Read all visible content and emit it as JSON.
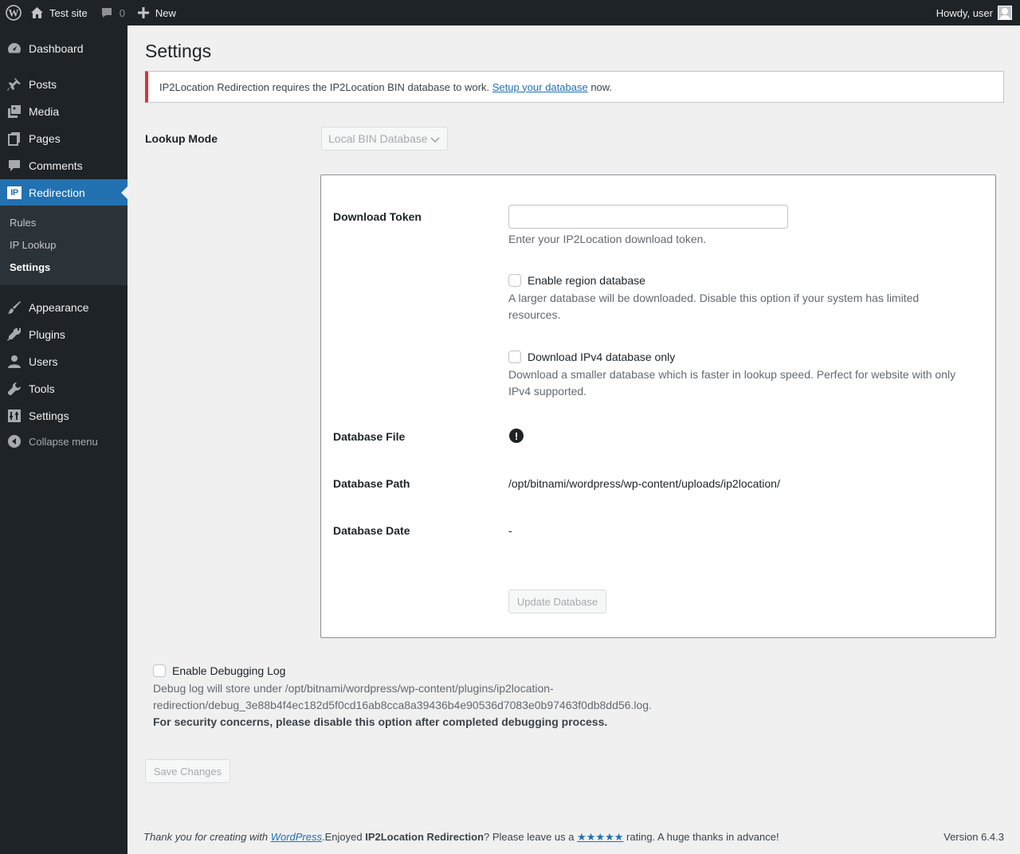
{
  "admin_bar": {
    "site_name": "Test site",
    "comments_count": "0",
    "new_label": "New",
    "greeting": "Howdy, user"
  },
  "sidebar": {
    "items": [
      {
        "label": "Dashboard",
        "icon": "dashboard-icon"
      },
      {
        "label": "Posts",
        "icon": "pin-icon"
      },
      {
        "label": "Media",
        "icon": "media-icon"
      },
      {
        "label": "Pages",
        "icon": "pages-icon"
      },
      {
        "label": "Comments",
        "icon": "comment-icon"
      },
      {
        "label": "Redirection",
        "icon": "ip2location-logo-icon",
        "logo_text": "IP",
        "active": true
      },
      {
        "label": "Appearance",
        "icon": "brush-icon"
      },
      {
        "label": "Plugins",
        "icon": "plugin-icon"
      },
      {
        "label": "Users",
        "icon": "user-icon"
      },
      {
        "label": "Tools",
        "icon": "wrench-icon"
      },
      {
        "label": "Settings",
        "icon": "settings-icon"
      }
    ],
    "submenu": [
      {
        "label": "Rules"
      },
      {
        "label": "IP Lookup"
      },
      {
        "label": "Settings",
        "current": true
      }
    ],
    "collapse_label": "Collapse menu"
  },
  "page": {
    "title": "Settings",
    "notice": {
      "text_before": "IP2Location Redirection requires the IP2Location BIN database to work.",
      "link": "Setup your database",
      "text_after": "now."
    },
    "lookup_mode": {
      "label": "Lookup Mode",
      "selected": "Local BIN Database"
    },
    "download_token": {
      "label": "Download Token",
      "value": "",
      "description": "Enter your IP2Location download token."
    },
    "region_db": {
      "label": "Enable region database",
      "checked": false,
      "description_line1": "A larger database will be downloaded. Disable this option if your system has limited",
      "description_line2": "resources."
    },
    "ipv4_only": {
      "label": "Download IPv4 database only",
      "checked": false,
      "description_line1": "Download a smaller database which is faster in lookup speed. Perfect for website with only",
      "description_line2": "IPv4 supported."
    },
    "database_file": {
      "label": "Database File",
      "icon": "exclamation-circle-icon",
      "icon_text": "!"
    },
    "database_path": {
      "label": "Database Path",
      "value": "/opt/bitnami/wordpress/wp-content/uploads/ip2location/"
    },
    "database_date": {
      "label": "Database Date",
      "value": "-"
    },
    "update_button": "Update Database",
    "debug": {
      "label": "Enable Debugging Log",
      "checked": false,
      "line1": "Debug log will store under /opt/bitnami/wordpress/wp-content/plugins/ip2location-",
      "line2": "redirection/debug_3e88b4f4ec182d5f0cd16ab8cca8a39436b4e90536d7083e0b97463f0db8dd56.log.",
      "warning": "For security concerns, please disable this option after completed debugging process."
    },
    "save_button": "Save Changes"
  },
  "footer": {
    "thanks": "Thank you for creating with",
    "wp_link": "WordPress",
    "enjoyed": ".Enjoyed",
    "plugin_name": "IP2Location Redirection",
    "leave": "? Please leave us a",
    "stars": "★★★★★",
    "rating": "rating. A huge thanks in advance!",
    "version": "Version 6.4.3"
  },
  "colors": {
    "admin_bar": "#1d2327",
    "accent": "#2271b1",
    "notice_error": "#d63638",
    "background": "#f0f0f1"
  }
}
